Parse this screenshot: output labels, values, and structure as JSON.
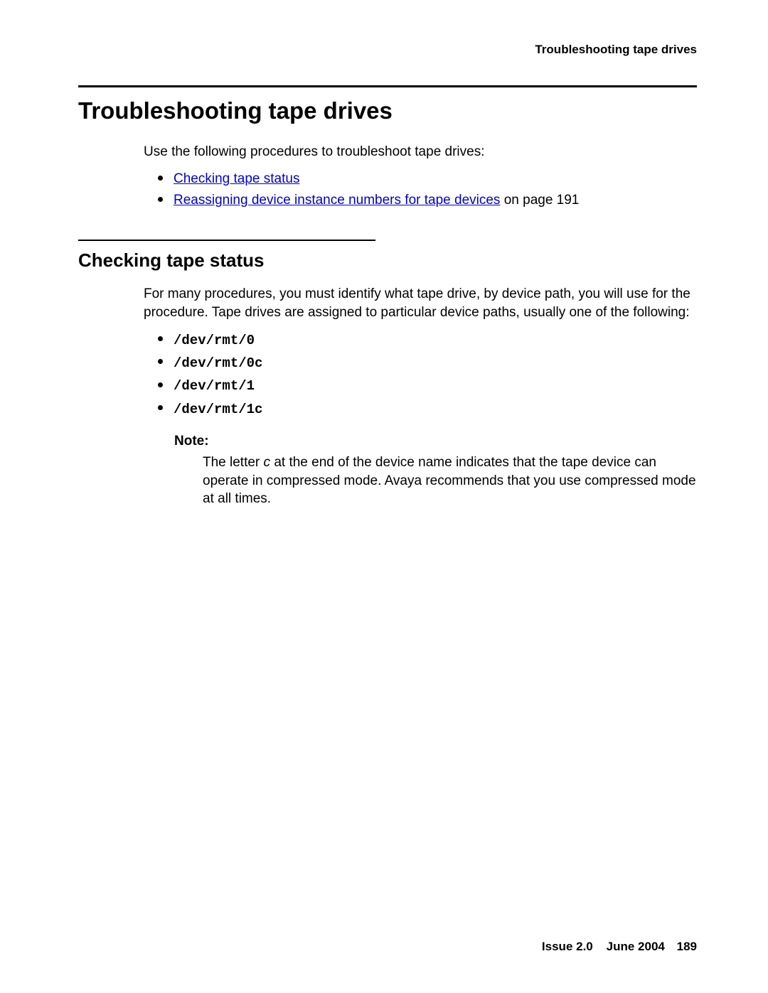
{
  "header": {
    "running_title": "Troubleshooting tape drives"
  },
  "chapter": {
    "title": "Troubleshooting tape drives",
    "intro": "Use the following procedures to troubleshoot tape drives:",
    "links": [
      {
        "text": "Checking tape status",
        "suffix": ""
      },
      {
        "text": "Reassigning device instance numbers for tape devices",
        "suffix": " on page 191"
      }
    ]
  },
  "section": {
    "title": "Checking tape status",
    "body": "For many procedures, you must identify what tape drive, by device path, you will use for the procedure. Tape drives are assigned to particular device paths, usually one of the following:",
    "device_paths": [
      "/dev/rmt/0",
      "/dev/rmt/0c",
      "/dev/rmt/1",
      "/dev/rmt/1c"
    ],
    "note": {
      "label": "Note:",
      "prefix": "The letter ",
      "em": "c",
      "rest": " at the end of the device name indicates that the tape device can operate in compressed mode. Avaya recommends that you use compressed mode at all times."
    }
  },
  "footer": {
    "issue": "Issue 2.0",
    "date": "June 2004",
    "page": "189"
  }
}
